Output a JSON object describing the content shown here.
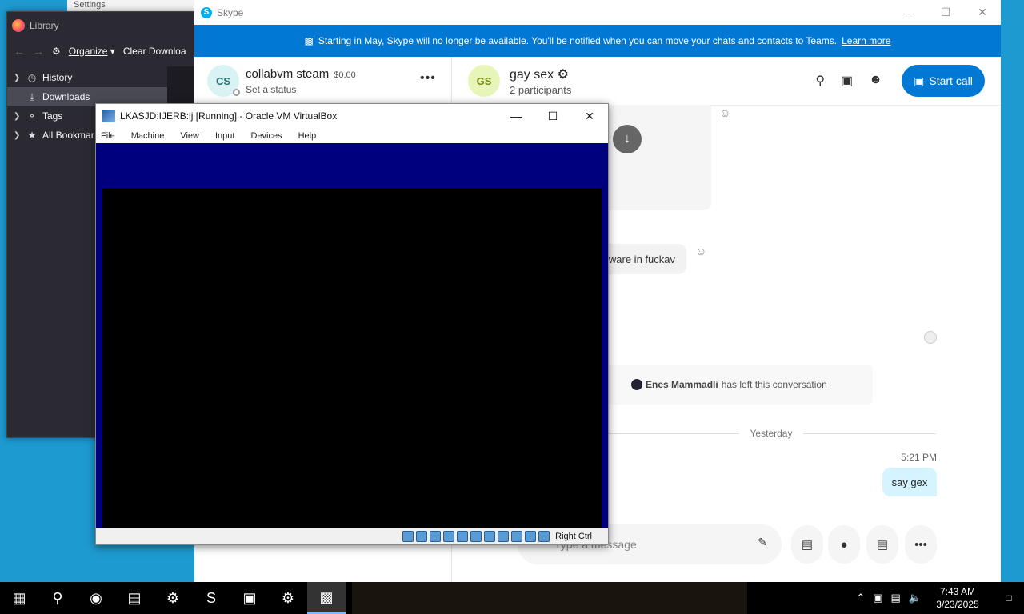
{
  "desktop": {
    "background": "#1d9ad0"
  },
  "settings_window": {
    "title": "Settings"
  },
  "library": {
    "title": "Library",
    "organize": "Organize",
    "clear": "Clear Downloa",
    "tree": [
      {
        "label": "History",
        "icon": "clock-icon"
      },
      {
        "label": "Downloads",
        "icon": "download-icon",
        "selected": true
      },
      {
        "label": "Tags",
        "icon": "tag-icon"
      },
      {
        "label": "All Bookmar",
        "icon": "star-icon"
      }
    ]
  },
  "skype": {
    "title": "Skype",
    "banner_text": "Starting in May, Skype will no longer be available. You'll be notified when you can move your chats and contacts to Teams.",
    "banner_link": "Learn more",
    "profile": {
      "initials": "CS",
      "name": "collabvm steam",
      "balance": "$0.00",
      "status": "Set a status"
    },
    "chat": {
      "initials": "GS",
      "name": "gay sex",
      "participants": "2 participants",
      "start_call": "Start call"
    },
    "messages": {
      "partial_text": "lware in fuckav",
      "left_user": "Enes Mammadli",
      "left_text": "has left this conversation",
      "divider": "Yesterday",
      "time": "5:21 PM",
      "sent": "say gex"
    },
    "composer_placeholder": "Type a message"
  },
  "vbox": {
    "title": "LKASJD:IJERB:lj [Running] - Oracle VM VirtualBox",
    "menu": [
      "File",
      "Machine",
      "View",
      "Input",
      "Devices",
      "Help"
    ],
    "host_key": "Right Ctrl",
    "screen_color": "#00007e"
  },
  "taskbar": {
    "time": "7:43 AM",
    "date": "3/23/2025",
    "apps": [
      "start-icon",
      "search-icon",
      "firefox-icon",
      "file-explorer-icon",
      "steam-icon",
      "skype-icon",
      "virtualbox-icon",
      "settings-icon",
      "vm-console-icon"
    ]
  }
}
